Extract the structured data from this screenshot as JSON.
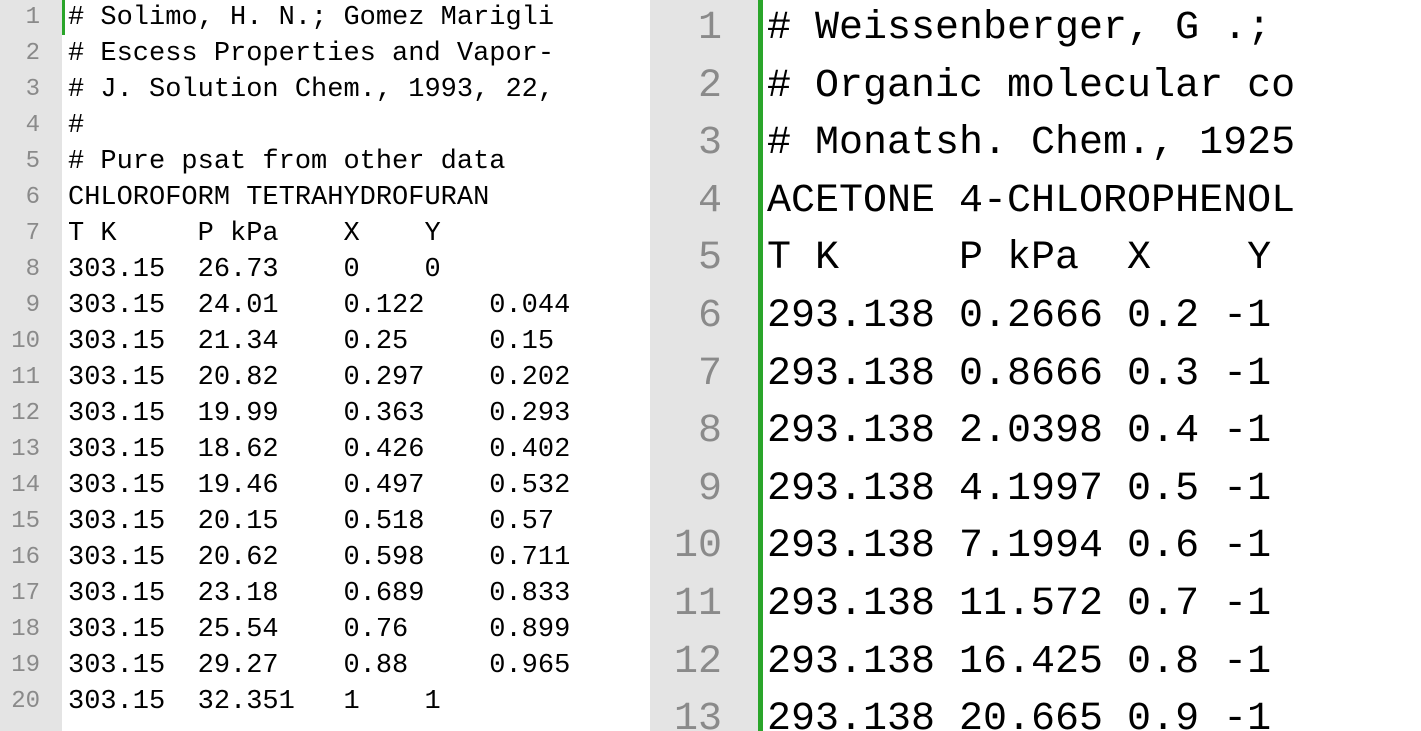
{
  "left_editor": {
    "lines": [
      {
        "n": "1",
        "text": "# Solimo, H. N.; Gomez Marigli"
      },
      {
        "n": "2",
        "text": "# Escess Properties and Vapor-"
      },
      {
        "n": "3",
        "text": "# J. Solution Chem., 1993, 22,"
      },
      {
        "n": "4",
        "text": "#"
      },
      {
        "n": "5",
        "text": "# Pure psat from other data"
      },
      {
        "n": "6",
        "text": "CHLOROFORM TETRAHYDROFURAN"
      },
      {
        "n": "7",
        "text": "T K     P kPa    X    Y"
      },
      {
        "n": "8",
        "text": "303.15  26.73    0    0"
      },
      {
        "n": "9",
        "text": "303.15  24.01    0.122    0.044"
      },
      {
        "n": "10",
        "text": "303.15  21.34    0.25     0.15"
      },
      {
        "n": "11",
        "text": "303.15  20.82    0.297    0.202"
      },
      {
        "n": "12",
        "text": "303.15  19.99    0.363    0.293"
      },
      {
        "n": "13",
        "text": "303.15  18.62    0.426    0.402"
      },
      {
        "n": "14",
        "text": "303.15  19.46    0.497    0.532"
      },
      {
        "n": "15",
        "text": "303.15  20.15    0.518    0.57"
      },
      {
        "n": "16",
        "text": "303.15  20.62    0.598    0.711"
      },
      {
        "n": "17",
        "text": "303.15  23.18    0.689    0.833"
      },
      {
        "n": "18",
        "text": "303.15  25.54    0.76     0.899"
      },
      {
        "n": "19",
        "text": "303.15  29.27    0.88     0.965"
      },
      {
        "n": "20",
        "text": "303.15  32.351   1    1"
      }
    ]
  },
  "right_editor": {
    "lines": [
      {
        "n": "1",
        "text": "# Weissenberger, G .;"
      },
      {
        "n": "2",
        "text": "# Organic molecular co"
      },
      {
        "n": "3",
        "text": "# Monatsh. Chem., 1925"
      },
      {
        "n": "4",
        "text": "ACETONE 4-CHLOROPHENOL"
      },
      {
        "n": "5",
        "text": "T K     P kPa  X    Y"
      },
      {
        "n": "6",
        "text": "293.138 0.2666 0.2 -1"
      },
      {
        "n": "7",
        "text": "293.138 0.8666 0.3 -1"
      },
      {
        "n": "8",
        "text": "293.138 2.0398 0.4 -1"
      },
      {
        "n": "9",
        "text": "293.138 4.1997 0.5 -1"
      },
      {
        "n": "10",
        "text": "293.138 7.1994 0.6 -1"
      },
      {
        "n": "11",
        "text": "293.138 11.572 0.7 -1"
      },
      {
        "n": "12",
        "text": "293.138 16.425 0.8 -1"
      },
      {
        "n": "13",
        "text": "293.138 20.665 0.9 -1"
      }
    ]
  },
  "colors": {
    "gutter": "#e4e4e4",
    "line_number": "#8a8a8a",
    "active_line_marker": "#2aa52a",
    "text": "#000000",
    "background": "#ffffff"
  }
}
